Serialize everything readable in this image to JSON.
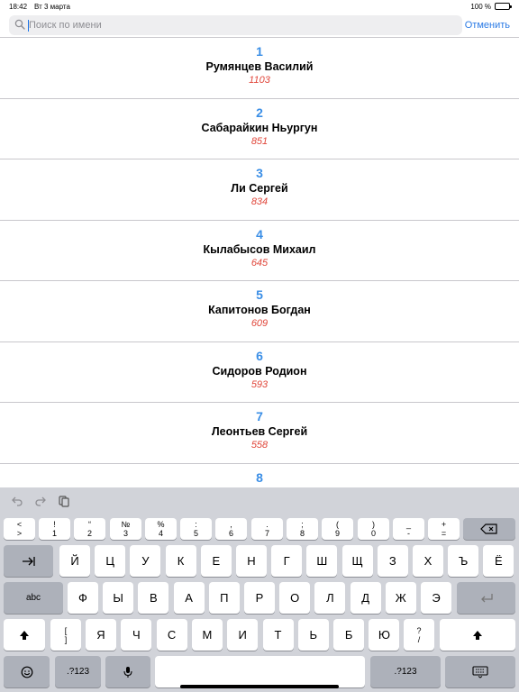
{
  "status": {
    "time": "18:42",
    "date": "Вт 3 марта",
    "battery_text": "100 %",
    "battery_level": 1.0
  },
  "search": {
    "placeholder": "Поиск по имени",
    "cancel_label": "Отменить"
  },
  "colors": {
    "accent": "#2c7be5",
    "rank": "#3a8ee6",
    "score": "#e0463a"
  },
  "players": [
    {
      "rank": "1",
      "name": "Румянцев Василий",
      "score": "1103"
    },
    {
      "rank": "2",
      "name": "Сабарайкин Ньургун",
      "score": "851"
    },
    {
      "rank": "3",
      "name": "Ли Сергей",
      "score": "834"
    },
    {
      "rank": "4",
      "name": "Кылабысов Михаил",
      "score": "645"
    },
    {
      "rank": "5",
      "name": "Капитонов Богдан",
      "score": "609"
    },
    {
      "rank": "6",
      "name": "Сидоров Родион",
      "score": "593"
    },
    {
      "rank": "7",
      "name": "Леонтьев Сергей",
      "score": "558"
    },
    {
      "rank": "8",
      "name": "",
      "score": ""
    }
  ],
  "keyboard": {
    "toolbar": [
      "undo-icon",
      "redo-icon",
      "paste-icon"
    ],
    "row1": [
      [
        "<",
        ">"
      ],
      [
        "!",
        "1"
      ],
      [
        "“",
        "2"
      ],
      [
        "№",
        "3"
      ],
      [
        "%",
        "4"
      ],
      [
        ":",
        "5"
      ],
      [
        ",",
        "6"
      ],
      [
        ".",
        "7"
      ],
      [
        ";",
        "8"
      ],
      [
        "(",
        "9"
      ],
      [
        ")",
        "0"
      ],
      [
        "_",
        "-"
      ],
      [
        "+",
        "="
      ]
    ],
    "row2": [
      "Й",
      "Ц",
      "У",
      "К",
      "Е",
      "Н",
      "Г",
      "Ш",
      "Щ",
      "З",
      "Х",
      "Ъ",
      "Ё"
    ],
    "row3": [
      "Ф",
      "Ы",
      "В",
      "А",
      "П",
      "Р",
      "О",
      "Л",
      "Д",
      "Ж",
      "Э"
    ],
    "row4_bracket": [
      "[",
      "]"
    ],
    "row4": [
      "Я",
      "Ч",
      "С",
      "М",
      "И",
      "Т",
      "Ь",
      "Б",
      "Ю"
    ],
    "row4_question": [
      "?",
      "/"
    ],
    "abc_label": "abc",
    "numbers_label": ".?123"
  }
}
